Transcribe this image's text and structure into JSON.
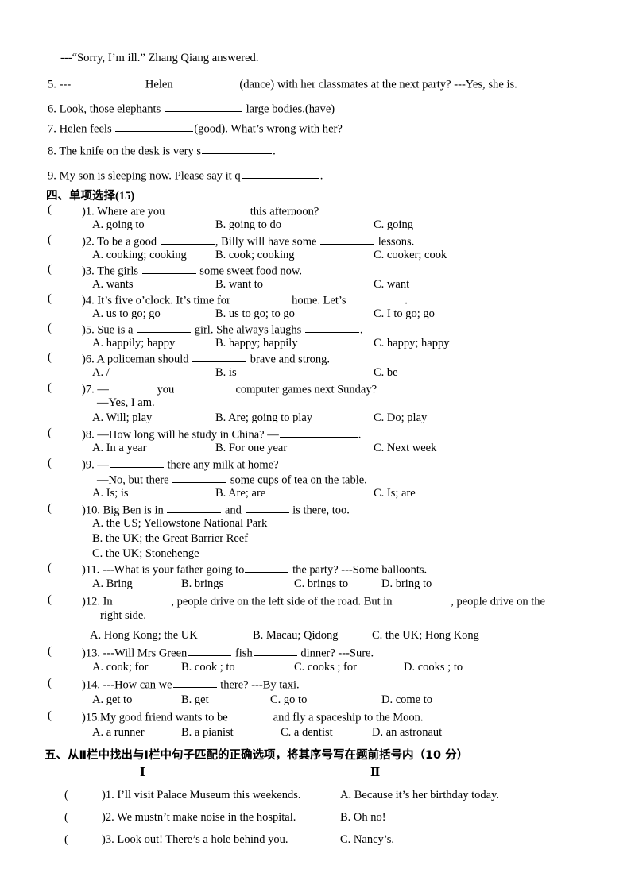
{
  "page": {
    "background": "#ffffff",
    "text_color": "#000000"
  },
  "fill_in_blanks": {
    "continuation_line": "---“Sorry, I’m ill.” Zhang Qiang answered.",
    "items": [
      {
        "number": "5.",
        "pre": "---",
        "mid": " Helen ",
        "post": "(dance) with her classmates at the next party? ---Yes, she is."
      },
      {
        "number": "6.",
        "pre": "Look, those elephants ",
        "post": " large bodies.(have)"
      },
      {
        "number": "7.",
        "pre": "Helen feels ",
        "post": "(good). What’s wrong with her?"
      },
      {
        "number": "8.",
        "pre": "The knife on the desk is very ",
        "seed": "s",
        "post": "."
      },
      {
        "number": "9.",
        "pre": "My son is sleeping now. Please say it ",
        "seed": "q",
        "post": "."
      }
    ]
  },
  "section_four": {
    "heading_cn": "四、单项选择",
    "heading_score": "(15)",
    "questions": [
      {
        "num": ")1.",
        "stem_pre": "Where are you ",
        "stem_post": " this afternoon?",
        "options": [
          "A. going to",
          "B. going to do",
          "C. going"
        ]
      },
      {
        "num": ")2.",
        "stem_pre": "To be a good ",
        "stem_mid": ", Billy will have some ",
        "stem_post": " lessons.",
        "options": [
          "A. cooking; cooking",
          "B. cook; cooking",
          "C. cooker; cook"
        ]
      },
      {
        "num": ")3.",
        "stem_pre": "The girls ",
        "stem_post": " some sweet food now.",
        "options": [
          "A. wants",
          "B. want to",
          "C. want"
        ]
      },
      {
        "num": ")4.",
        "stem_pre": "It’s five o’clock. It’s time for ",
        "stem_mid": " home. Let’s ",
        "stem_post": ".",
        "options": [
          "A. us to go; go",
          "B. us to go; to go",
          "C. I to go; go"
        ]
      },
      {
        "num": ")5.",
        "stem_pre": "Sue is a ",
        "stem_mid": " girl. She always laughs ",
        "stem_post": ".",
        "options": [
          "A. happily; happy",
          "B. happy; happily",
          "C. happy; happy"
        ]
      },
      {
        "num": ")6.",
        "stem_pre": "A policeman should ",
        "stem_post": " brave and strong.",
        "options": [
          "A. /",
          "B. is",
          "C. be"
        ]
      },
      {
        "num": ")7.",
        "stem_pre": "—",
        "stem_mid": " you ",
        "stem_post": " computer games next Sunday?",
        "stem_line2": "—Yes, I am.",
        "options": [
          "A. Will; play",
          "B. Are; going to play",
          "C. Do; play"
        ]
      },
      {
        "num": ")8.",
        "stem_pre": "—How long will he study in China?        —",
        "stem_post": ".",
        "options": [
          "A. In a year",
          "B. For one year",
          "C. Next week"
        ]
      },
      {
        "num": ")9.",
        "stem_pre": "—",
        "stem_post": " there any milk at home?",
        "stem_line2_pre": "—No, but there ",
        "stem_line2_post": " some cups of tea on the table.",
        "options": [
          "A. Is; is",
          "B. Are; are",
          "C. Is; are"
        ]
      },
      {
        "num": ")10.",
        "stem_pre": "Big Ben is in ",
        "stem_mid": " and ",
        "stem_post": " is there, too.",
        "options": [
          "A. the US; Yellowstone National Park",
          "B. the UK; the Great Barrier Reef",
          "C. the UK; Stonehenge"
        ],
        "stacked": true
      },
      {
        "num": ")11.",
        "stem_pre": "---What is your father going to",
        "stem_post": " the party?    ---Some balloonts.",
        "options": [
          "A. Bring",
          "B. brings",
          "C. brings to",
          "D. bring to"
        ]
      },
      {
        "num": ")12.",
        "stem_pre": "In ",
        "stem_mid": ", people drive on the left side of the road. But in ",
        "stem_post": ", people drive on the",
        "stem_line2": "right side.",
        "options": [
          "A.  Hong Kong; the UK",
          "B. Macau; Qidong",
          "C. the UK; Hong Kong"
        ]
      },
      {
        "num": ")13.",
        "stem_pre": "---Will Mrs Green",
        "stem_mid": " fish",
        "stem_post": " dinner?     ---Sure.",
        "options": [
          "A. cook; for",
          "B. cook ; to",
          "C. cooks ; for",
          "D. cooks ; to"
        ]
      },
      {
        "num": ")14.",
        "stem_pre": "---How can we",
        "stem_post": " there?   ---By taxi.",
        "options": [
          "A. get to",
          "B. get",
          "C. go to",
          "D. come to"
        ]
      },
      {
        "num": ")15.",
        "stem_pre": "My good friend wants to be",
        "stem_post": "and fly a spaceship to the Moon.",
        "options": [
          "A. a runner",
          "B. a pianist",
          "C. a dentist",
          "D. an astronaut"
        ]
      }
    ],
    "paren_open": "("
  },
  "section_five": {
    "heading": "五、从Ⅱ栏中找出与Ⅰ栏中句子匹配的正确选项，将其序号写在题前括号内（10 分）",
    "column_head_left": "Ⅰ",
    "column_head_right": "Ⅱ",
    "paren_open": "(",
    "rows": [
      {
        "num": ")1.",
        "left": "I’ll visit Palace Museum this weekends.",
        "right": "A. Because it’s her birthday today."
      },
      {
        "num": ")2.",
        "left": "We mustn’t make noise in the hospital.",
        "right": "B. Oh no!"
      },
      {
        "num": ")3.",
        "left": "Look out! There’s a hole behind you.",
        "right": "C. Nancy’s."
      }
    ]
  }
}
